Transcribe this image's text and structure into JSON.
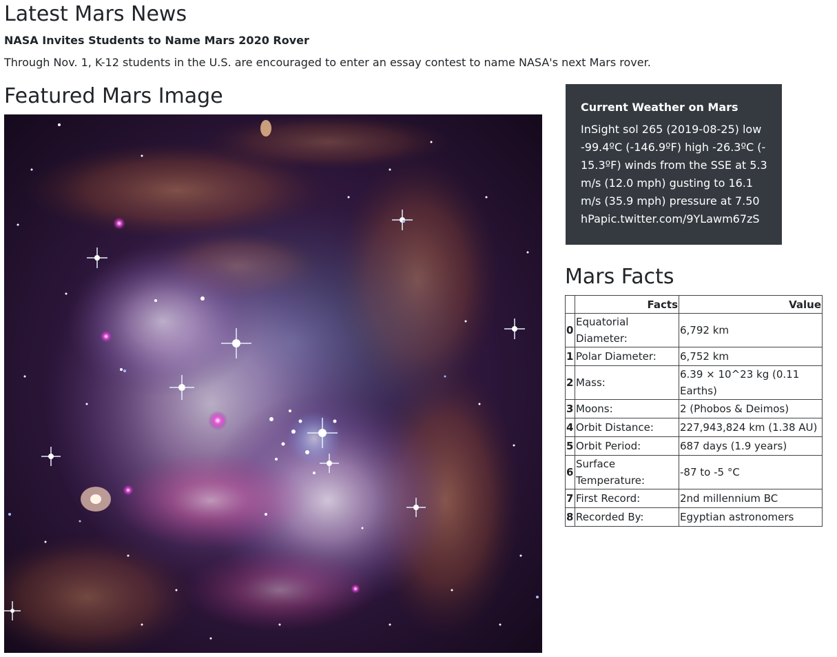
{
  "news": {
    "section_title": "Latest Mars News",
    "headline": "NASA Invites Students to Name Mars 2020 Rover",
    "teaser": "Through Nov. 1, K-12 students in the U.S. are encouraged to enter an essay contest to name NASA's next Mars rover."
  },
  "featured": {
    "section_title": "Featured Mars Image"
  },
  "weather": {
    "title": "Current Weather on Mars",
    "text": "InSight sol 265 (2019-08-25) low -99.4ºC (-146.9ºF) high -26.3ºC (-15.3ºF) winds from the SSE at 5.3 m/s (12.0 mph) gusting to 16.1 m/s (35.9 mph) pressure at 7.50 hPapic.twitter.com/9YLawm67zS"
  },
  "facts": {
    "section_title": "Mars Facts",
    "columns": [
      "",
      "Facts",
      "Value"
    ],
    "rows": [
      {
        "index": "0",
        "fact": "Equatorial Diameter:",
        "value": "6,792 km"
      },
      {
        "index": "1",
        "fact": "Polar Diameter:",
        "value": "6,752 km"
      },
      {
        "index": "2",
        "fact": "Mass:",
        "value": "6.39 × 10^23 kg (0.11 Earths)"
      },
      {
        "index": "3",
        "fact": "Moons:",
        "value": "2 (Phobos & Deimos)"
      },
      {
        "index": "4",
        "fact": "Orbit Distance:",
        "value": "227,943,824 km (1.38 AU)"
      },
      {
        "index": "5",
        "fact": "Orbit Period:",
        "value": "687 days (1.9 years)"
      },
      {
        "index": "6",
        "fact": "Surface Temperature:",
        "value": "-87 to -5 °C"
      },
      {
        "index": "7",
        "fact": "First Record:",
        "value": "2nd millennium BC"
      },
      {
        "index": "8",
        "fact": "Recorded By:",
        "value": "Egyptian astronomers"
      }
    ]
  }
}
